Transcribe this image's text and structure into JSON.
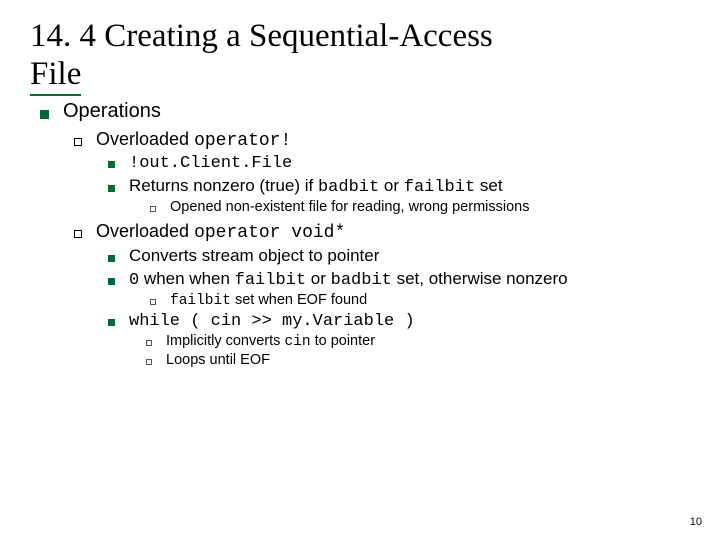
{
  "title": {
    "line1": "14. 4  Creating a Sequential-Access",
    "line2": "File"
  },
  "bullets": {
    "operations": "Operations",
    "overloaded1_pre": "Overloaded ",
    "overloaded1_code": "operator!",
    "b1a": "!out.Client.File",
    "b1b_pre": "Returns nonzero (true) if ",
    "b1b_code1": "badbit",
    "b1b_mid": " or ",
    "b1b_code2": "failbit",
    "b1b_post": " set",
    "b1b_sub": "Opened non-existent file for reading, wrong permissions",
    "overloaded2_pre": "Overloaded ",
    "overloaded2_code": "operator void*",
    "b2a": "Converts stream object to pointer",
    "b2b_code1": "0",
    "b2b_mid1": " when when ",
    "b2b_code2": "failbit",
    "b2b_mid2": " or ",
    "b2b_code3": "badbit",
    "b2b_post": " set, otherwise nonzero",
    "b2b_sub_code": "failbit",
    "b2b_sub_post": " set when EOF found",
    "b2c": "while ( cin >> my.Variable )",
    "b2c_sub1_pre": "Implicitly converts ",
    "b2c_sub1_code": "cin",
    "b2c_sub1_post": " to pointer",
    "b2c_sub2": "Loops until EOF"
  },
  "page_number": "10"
}
